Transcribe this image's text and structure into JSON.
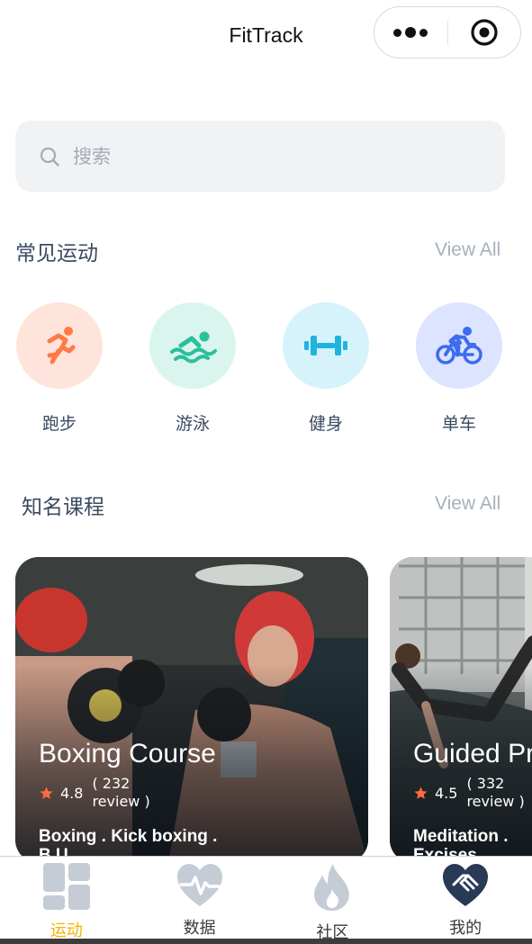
{
  "app": {
    "title": "FitTrack"
  },
  "search": {
    "placeholder": "搜索"
  },
  "sports_section": {
    "title": "常见运动",
    "view_all": "View All"
  },
  "sports": [
    {
      "label": "跑步",
      "icon": "running-icon",
      "bg": "#ffe4dc",
      "color": "#ff7a45"
    },
    {
      "label": "游泳",
      "icon": "swimming-icon",
      "bg": "#d9f5ee",
      "color": "#2bbf9b"
    },
    {
      "label": "健身",
      "icon": "dumbbell-icon",
      "bg": "#d6f3fb",
      "color": "#1fb3e0"
    },
    {
      "label": "单车",
      "icon": "cycling-icon",
      "bg": "#dde4ff",
      "color": "#3c6cf0"
    }
  ],
  "courses_section": {
    "title": "知名课程",
    "view_all": "View All"
  },
  "courses": [
    {
      "title": "Boxing Course",
      "rating": "4.8",
      "reviews": "( 232 review )",
      "tags": "Boxing . Kick boxing . B.U"
    },
    {
      "title": "Guided Pr",
      "rating": "4.5",
      "reviews": "( 332 review )",
      "tags": "Meditation . Excises"
    }
  ],
  "tabbar": {
    "active_color": "#f4b400",
    "items": [
      {
        "label": "运动",
        "icon": "grid-icon",
        "active": true
      },
      {
        "label": "数据",
        "icon": "heart-pulse-icon",
        "active": false
      },
      {
        "label": "社区",
        "icon": "flame-icon",
        "active": false
      },
      {
        "label": "我的",
        "icon": "handshake-heart-icon",
        "active": false
      }
    ]
  },
  "colors": {
    "star": "#ff6b3d",
    "section_title": "#3b4a60",
    "view_all": "#a7b0bd",
    "search_bg": "#f1f2f4"
  }
}
